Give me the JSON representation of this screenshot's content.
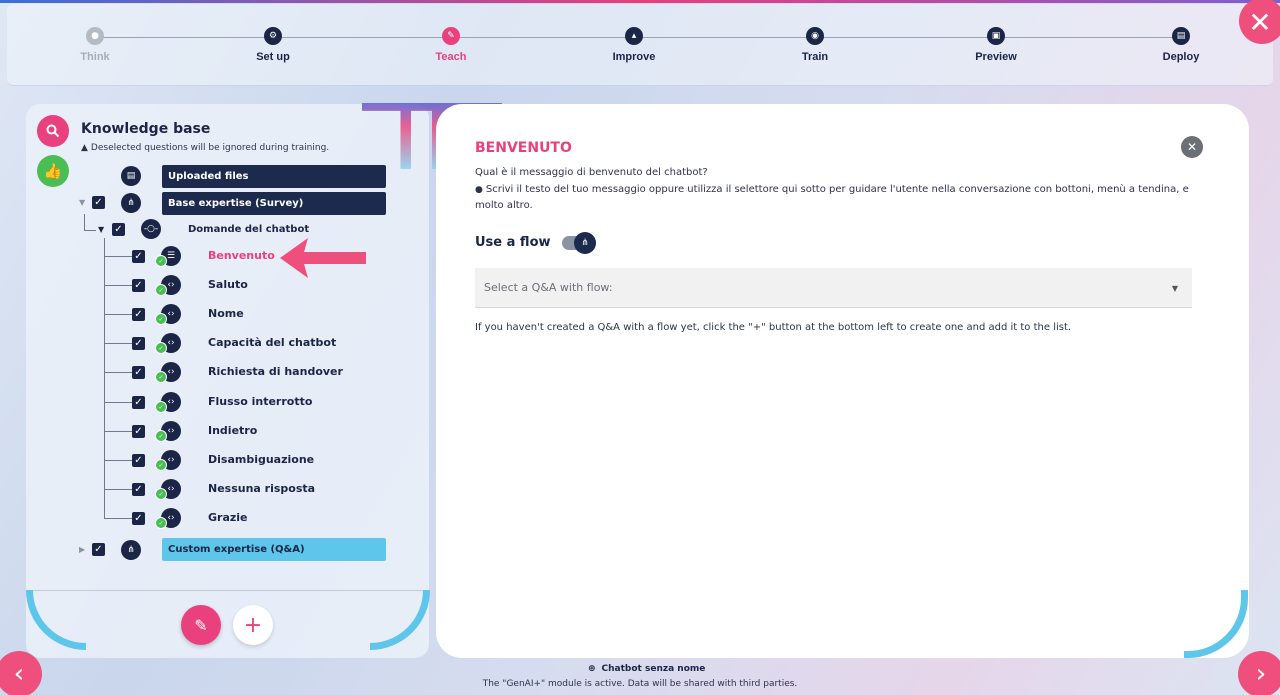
{
  "stepper": {
    "steps": [
      {
        "label": "Think",
        "state": "muted",
        "icon": "lightbulb-icon"
      },
      {
        "label": "Set up",
        "state": "done",
        "icon": "gear-icon"
      },
      {
        "label": "Teach",
        "state": "active",
        "icon": "pencil-icon"
      },
      {
        "label": "Improve",
        "state": "done",
        "icon": "chart-icon"
      },
      {
        "label": "Train",
        "state": "done",
        "icon": "brain-icon"
      },
      {
        "label": "Preview",
        "state": "done",
        "icon": "preview-icon"
      },
      {
        "label": "Deploy",
        "state": "done",
        "icon": "deploy-icon"
      }
    ]
  },
  "knowledge_base": {
    "title": "Knowledge base",
    "subtitle": "Deselected questions will be ignored during training.",
    "uploaded_files": "Uploaded files",
    "base_expertise": "Base expertise (Survey)",
    "group_label": "Domande del chatbot",
    "items": [
      {
        "label": "Benvenuto",
        "active": true
      },
      {
        "label": "Saluto",
        "active": false
      },
      {
        "label": "Nome",
        "active": false
      },
      {
        "label": "Capacità del chatbot",
        "active": false
      },
      {
        "label": "Richiesta di handover",
        "active": false
      },
      {
        "label": "Flusso interrotto",
        "active": false
      },
      {
        "label": "Indietro",
        "active": false
      },
      {
        "label": "Disambiguazione",
        "active": false
      },
      {
        "label": "Nessuna risposta",
        "active": false
      },
      {
        "label": "Grazie",
        "active": false
      }
    ],
    "custom_expertise": "Custom expertise (Q&A)"
  },
  "editor": {
    "title": "BENVENUTO",
    "question": "Qual è il messaggio di benvenuto del chatbot?",
    "info": "Scrivi il testo del tuo messaggio oppure utilizza il selettore qui sotto per guidare l'utente nella conversazione con bottoni, menù a tendina, e molto altro.",
    "flow_label": "Use a flow",
    "select_placeholder": "Select a Q&A with flow:",
    "hint": "If you haven't created a Q&A with a flow yet, click the \"+\" button at the bottom left to create one and add it to the list."
  },
  "footer": {
    "chatbot_name": "Chatbot senza nome",
    "note": "The \"GenAI+\" module is active. Data will be shared with third parties."
  },
  "colors": {
    "accent": "#e8417e",
    "navy": "#1b2546",
    "success": "#4bbd55",
    "cyan": "#5ec6ea"
  }
}
